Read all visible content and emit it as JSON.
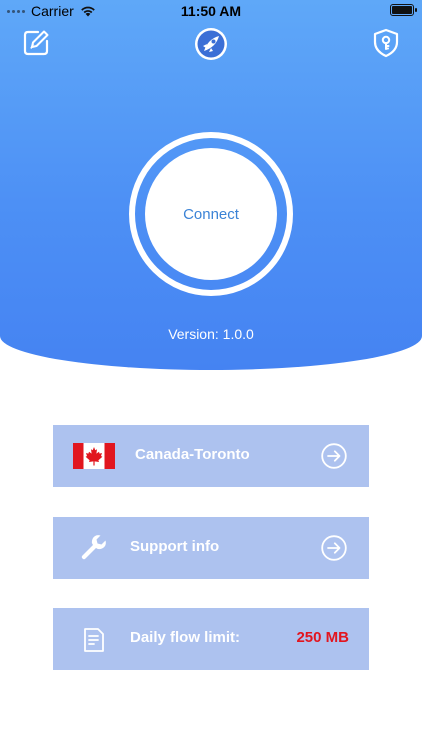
{
  "status_bar": {
    "carrier": "Carrier",
    "time": "11:50 AM"
  },
  "header": {
    "edit_icon": "edit-icon",
    "logo_icon": "rocket-logo-icon",
    "shield_icon": "shield-lock-icon",
    "background_color": "#4d90f5"
  },
  "connect": {
    "label": "Connect",
    "version": "Version: 1.0.0",
    "label_color": "#3b83d6"
  },
  "rows": {
    "server": {
      "label": "Canada-Toronto",
      "flag_icon": "canada-flag-icon",
      "action_icon": "arrow-right-circle-icon"
    },
    "support": {
      "label": "Support info",
      "icon": "wrench-icon",
      "action_icon": "arrow-right-circle-icon"
    },
    "flow": {
      "label": "Daily flow limit:",
      "value": "250 MB",
      "icon": "document-icon",
      "value_color": "#e2151f"
    }
  }
}
